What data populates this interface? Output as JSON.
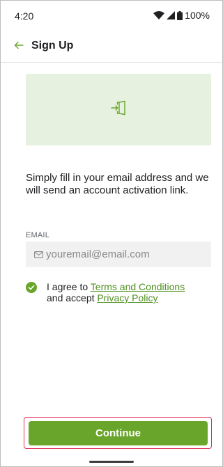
{
  "status_bar": {
    "time": "4:20",
    "battery": "100%",
    "icons": [
      "wifi-icon",
      "signal-icon",
      "battery-icon"
    ]
  },
  "app_bar": {
    "back_icon": "arrow-left-icon",
    "title": "Sign Up"
  },
  "hero": {
    "icon": "sign-in-door-icon",
    "background": "#e7f1df"
  },
  "intro": {
    "text": "Simply fill in your email address and we will send an account activation link."
  },
  "email": {
    "label": "EMAIL",
    "value": "",
    "placeholder": "youremail@email.com",
    "icon": "mail-icon"
  },
  "agreement": {
    "checked": true,
    "prefix": "I agree to ",
    "terms_link": "Terms and Conditions",
    "middle": " and accept ",
    "privacy_link": "Privacy Policy"
  },
  "actions": {
    "continue_label": "Continue"
  },
  "colors": {
    "accent": "#6aa52b",
    "link": "#4e8f1f",
    "highlight": "#e0315b"
  }
}
